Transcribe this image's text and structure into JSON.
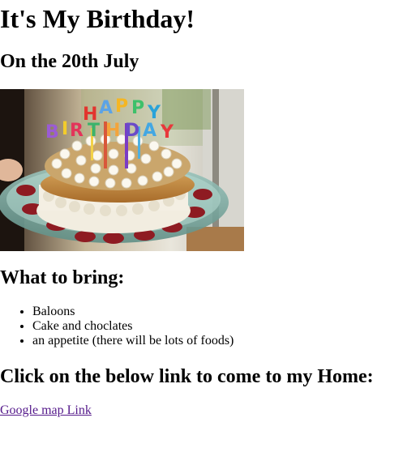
{
  "page": {
    "title": "It's My Birthday!",
    "date_heading": "On the 20th July",
    "image": {
      "alt": "birthday cake with candles",
      "icon": "birthday-cake-photo"
    },
    "bring_heading": "What to bring:",
    "bring_items": [
      "Baloons",
      "Cake and choclates",
      "an appetite (there will be lots of foods)"
    ],
    "home_heading": "Click on the below link to come to my Home:",
    "map_link": {
      "label": "Google map Link",
      "color": "#551a8b"
    }
  }
}
